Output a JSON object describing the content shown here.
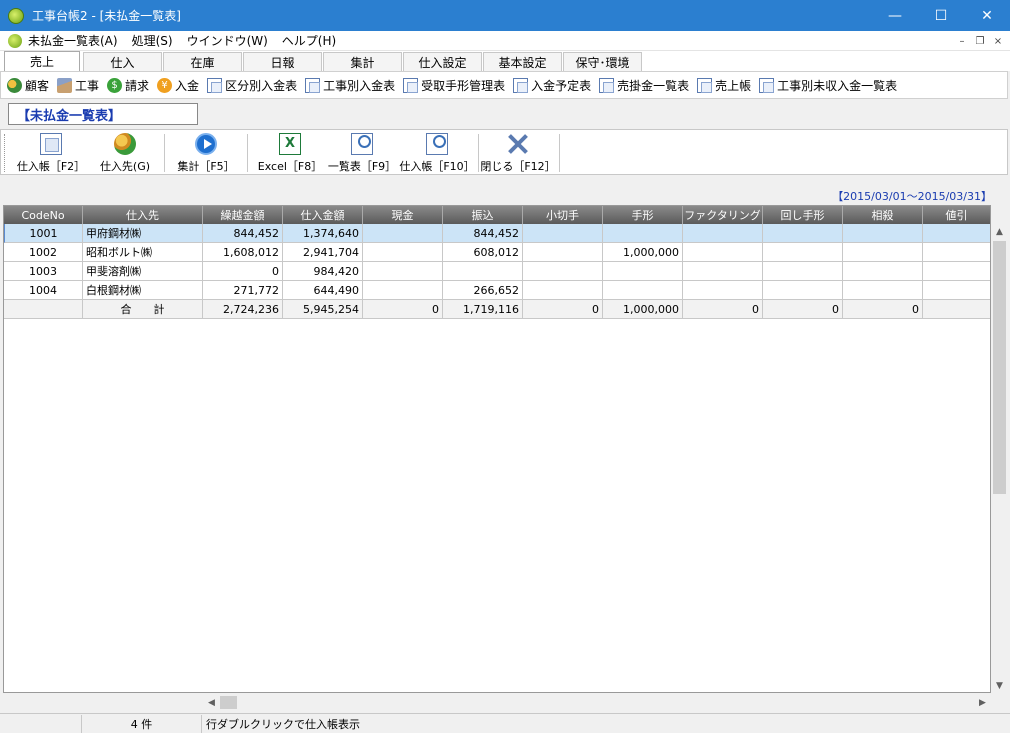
{
  "window": {
    "title": "工事台帳2 - [未払金一覧表]",
    "minimize": "—",
    "maximize": "☐",
    "close": "✕"
  },
  "menu": {
    "items": [
      "未払金一覧表(A)",
      "処理(S)",
      "ウインドウ(W)",
      "ヘルプ(H)"
    ],
    "mdi_min": "–",
    "mdi_restore": "❐",
    "mdi_close": "×"
  },
  "tabs": [
    "売上",
    "仕入",
    "在庫",
    "日報",
    "集計",
    "仕入設定",
    "基本設定",
    "保守･環境"
  ],
  "active_tab": "売上",
  "subnav": [
    "顧客",
    "工事",
    "請求",
    "入金",
    "区分別入金表",
    "工事別入金表",
    "受取手形管理表",
    "入金予定表",
    "売掛金一覧表",
    "売上帳",
    "工事別未収入金一覧表"
  ],
  "section_label": "【未払金一覧表】",
  "toolbar": {
    "purchase_ledger": "仕入帳［F2］",
    "supplier": "仕入先(G)",
    "aggregate": "集計［F5］",
    "excel": "Excel［F8］",
    "list": "一覧表［F9］",
    "purchase_ledger2": "仕入帳［F10］",
    "close": "閉じる［F12］",
    "excel_glyph": "X"
  },
  "date_range": "【2015/03/01～2015/03/31】",
  "grid": {
    "columns": [
      "CodeNo",
      "仕入先",
      "繰越金額",
      "仕入金額",
      "現金",
      "振込",
      "小切手",
      "手形",
      "ファクタリング",
      "回し手形",
      "相殺",
      "値引"
    ],
    "rows": [
      [
        "1001",
        "甲府鋼材㈱",
        "844,452",
        "1,374,640",
        "",
        "844,452",
        "",
        "",
        "",
        "",
        "",
        ""
      ],
      [
        "1002",
        "昭和ボルト㈱",
        "1,608,012",
        "2,941,704",
        "",
        "608,012",
        "",
        "1,000,000",
        "",
        "",
        "",
        ""
      ],
      [
        "1003",
        "甲斐溶剤㈱",
        "0",
        "984,420",
        "",
        "",
        "",
        "",
        "",
        "",
        "",
        ""
      ],
      [
        "1004",
        "白根鋼材㈱",
        "271,772",
        "644,490",
        "",
        "266,652",
        "",
        "",
        "",
        "",
        "",
        ""
      ]
    ],
    "total": [
      "",
      "合　　計",
      "2,724,236",
      "5,945,254",
      "0",
      "1,719,116",
      "0",
      "1,000,000",
      "0",
      "0",
      "0",
      ""
    ]
  },
  "scroll": {
    "up": "▲",
    "down": "▼",
    "left": "◀",
    "right": "▶"
  },
  "status": {
    "count": "4 件",
    "hint": "行ダブルクリックで仕入帳表示"
  }
}
